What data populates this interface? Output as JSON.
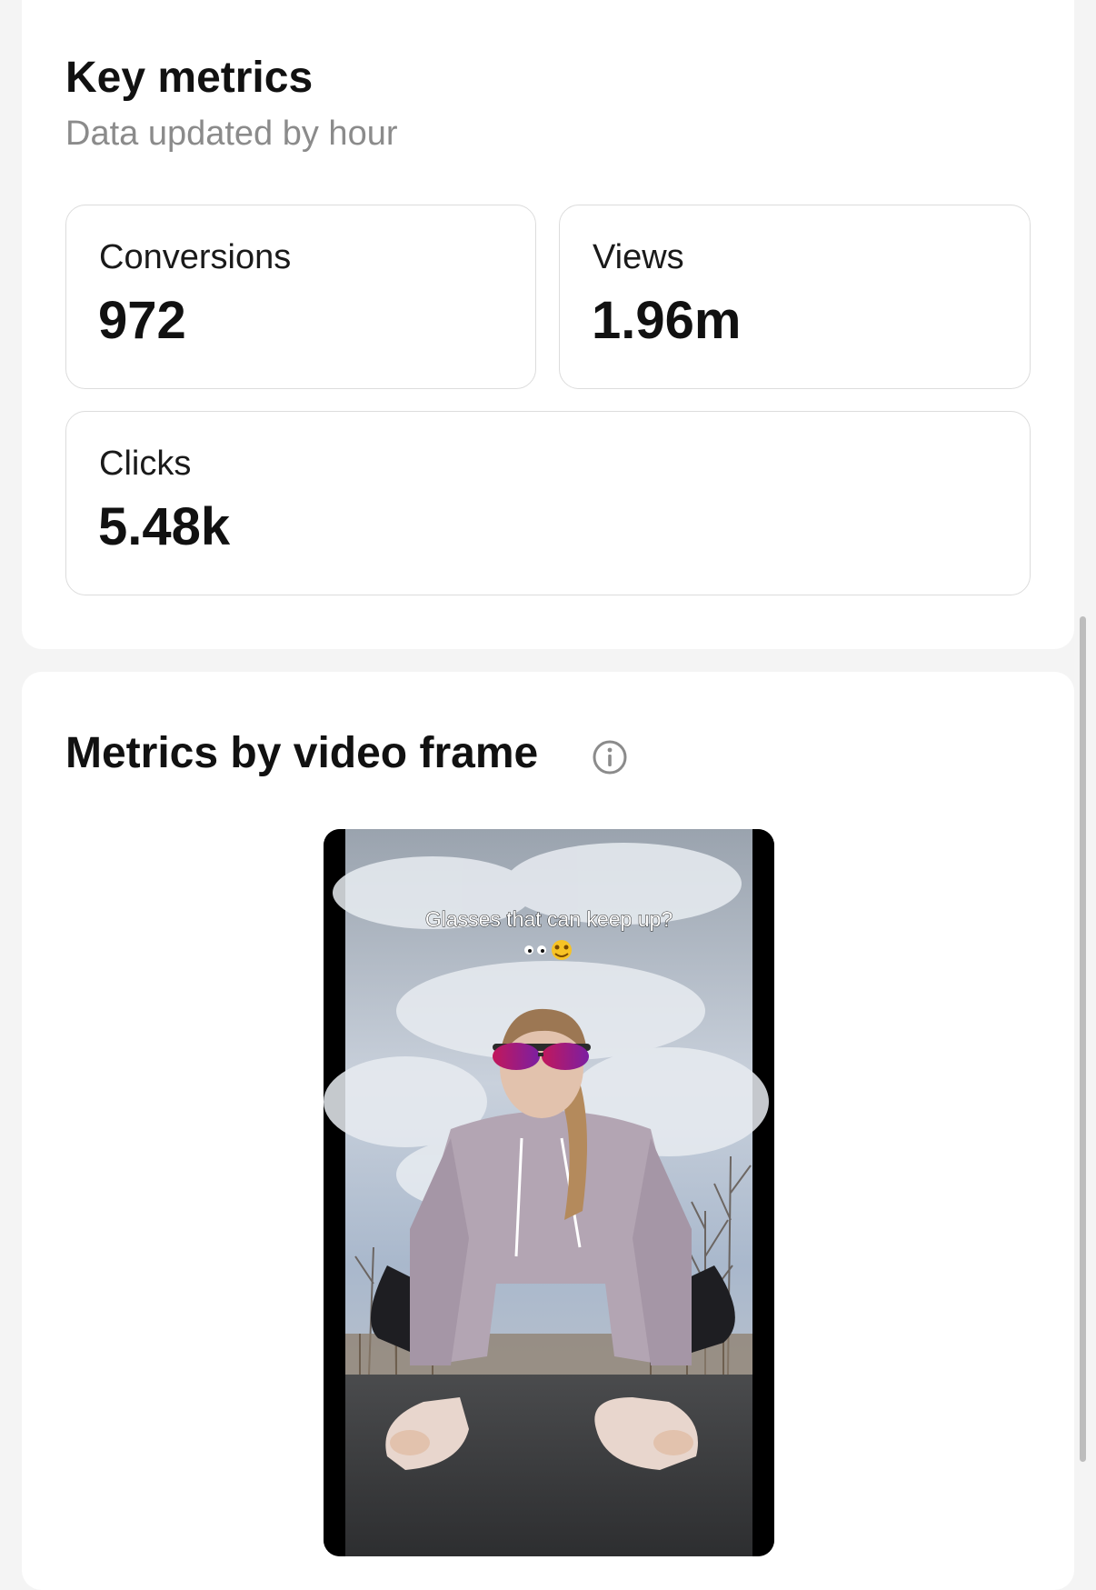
{
  "key_metrics": {
    "title": "Key metrics",
    "subtitle": "Data updated by hour",
    "conversions": {
      "label": "Conversions",
      "value": "972"
    },
    "views": {
      "label": "Views",
      "value": "1.96m"
    },
    "clicks": {
      "label": "Clicks",
      "value": "5.48k"
    }
  },
  "frame_metrics": {
    "title": "Metrics by video frame",
    "info_icon": "info-circle-icon",
    "video": {
      "caption": "Glasses that can keep up?",
      "caption_emoji": "eyes-and-starstruck-emoji"
    }
  },
  "colors": {
    "background": "#f4f4f4",
    "card": "#ffffff",
    "text_primary": "#111111",
    "text_secondary": "#8b8b8b",
    "border": "#dcdcdc"
  }
}
